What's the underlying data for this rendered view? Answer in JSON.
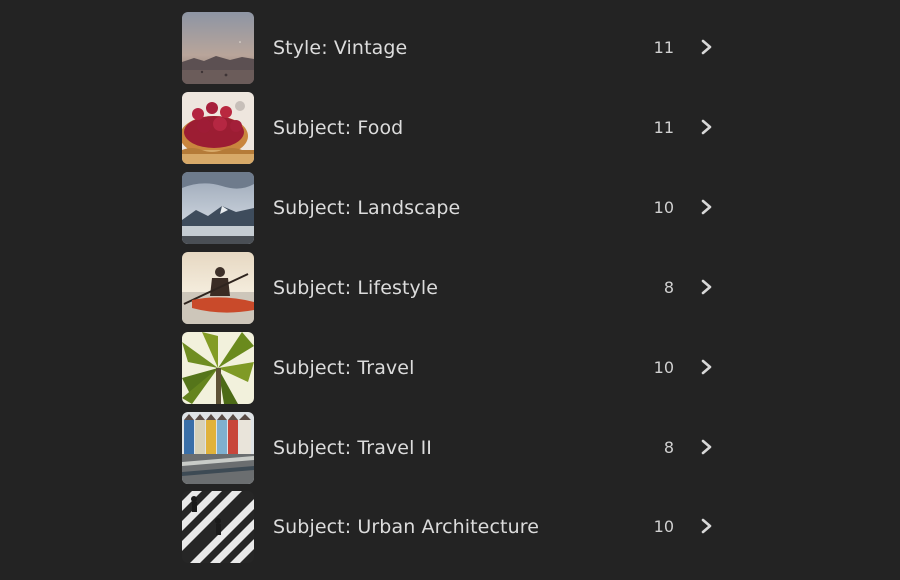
{
  "items": [
    {
      "label": "Style: Vintage",
      "count": "11",
      "thumbnail": "desert-dusk-photo"
    },
    {
      "label": "Subject: Food",
      "count": "11",
      "thumbnail": "raspberry-tart-photo"
    },
    {
      "label": "Subject: Landscape",
      "count": "10",
      "thumbnail": "mountain-lake-photo"
    },
    {
      "label": "Subject: Lifestyle",
      "count": "8",
      "thumbnail": "kayaker-sunset-photo"
    },
    {
      "label": "Subject: Travel",
      "count": "10",
      "thumbnail": "palm-tree-photo"
    },
    {
      "label": "Subject: Travel II",
      "count": "8",
      "thumbnail": "beach-huts-photo"
    },
    {
      "label": "Subject: Urban Architecture",
      "count": "10",
      "thumbnail": "crosswalk-photo"
    }
  ],
  "icons": {
    "chevron": "chevron-right-icon"
  },
  "colors": {
    "background": "#232323",
    "text": "#dcdcdc"
  }
}
